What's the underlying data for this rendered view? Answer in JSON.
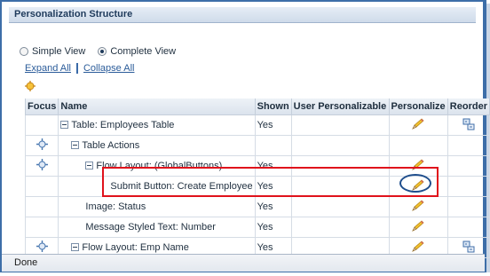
{
  "title": "Personalization Structure",
  "view": {
    "simple_label": "Simple View",
    "complete_label": "Complete View",
    "selected": "complete"
  },
  "links": {
    "expand_all": "Expand All",
    "collapse_all": "Collapse All"
  },
  "columns": {
    "focus": "Focus",
    "name": "Name",
    "shown": "Shown",
    "user_personalizable": "User Personalizable",
    "personalize": "Personalize",
    "reorder": "Reorder"
  },
  "rows": [
    {
      "name": "Table: Employees Table",
      "shown": "Yes",
      "focus": false,
      "expander": true,
      "personalize": true,
      "reorder": true
    },
    {
      "name": "Table Actions",
      "shown": "",
      "focus": true,
      "expander": true,
      "personalize": false,
      "reorder": false
    },
    {
      "name": "Flow Layout: (GlobalButtons)",
      "shown": "Yes",
      "focus": true,
      "expander": true,
      "personalize": true,
      "reorder": false
    },
    {
      "name": "Submit Button: Create Employee",
      "shown": "Yes",
      "focus": false,
      "expander": false,
      "personalize": true,
      "reorder": false
    },
    {
      "name": "Image: Status",
      "shown": "Yes",
      "focus": false,
      "expander": false,
      "personalize": true,
      "reorder": false
    },
    {
      "name": "Message Styled Text: Number",
      "shown": "Yes",
      "focus": false,
      "expander": false,
      "personalize": true,
      "reorder": false
    },
    {
      "name": "Flow Layout: Emp Name",
      "shown": "Yes",
      "focus": true,
      "expander": true,
      "personalize": true,
      "reorder": true
    }
  ],
  "status": "Done",
  "colors": {
    "accent": "#2b5c9a",
    "highlight_box": "#e0121c",
    "circle": "#1f4e8c",
    "pencil": "#f2c12e"
  }
}
